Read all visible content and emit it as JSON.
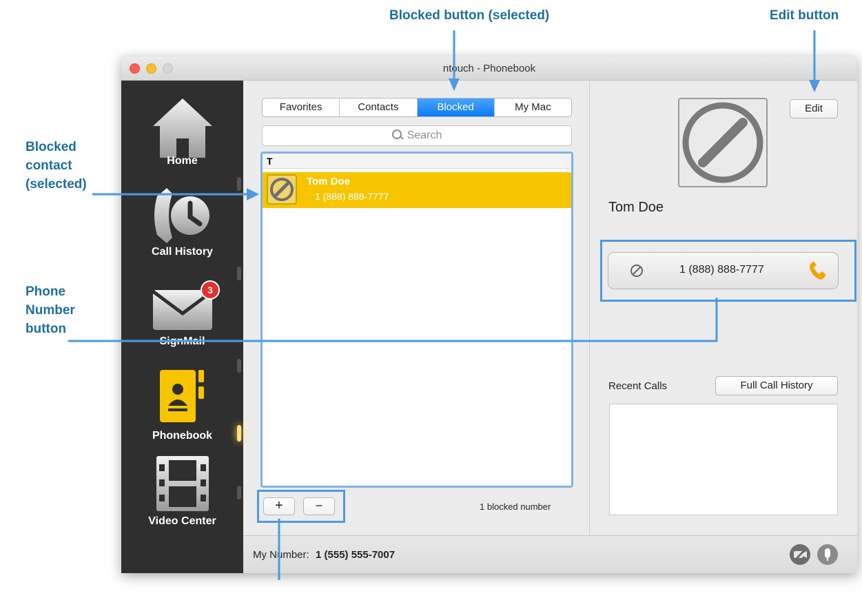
{
  "callouts": {
    "blocked_button": "Blocked button (selected)",
    "edit_button": "Edit button",
    "blocked_contact": [
      "Blocked",
      "contact",
      "(selected)"
    ],
    "phone_number_button": [
      "Phone",
      "Number",
      "button"
    ]
  },
  "window": {
    "title": "ntouch - Phonebook"
  },
  "sidebar": {
    "items": [
      {
        "label": "Home",
        "icon": "home-icon"
      },
      {
        "label": "Call History",
        "icon": "call-history-icon"
      },
      {
        "label": "SignMail",
        "icon": "signmail-icon",
        "badge": "3"
      },
      {
        "label": "Phonebook",
        "icon": "phonebook-icon",
        "active": true
      },
      {
        "label": "Video Center",
        "icon": "video-center-icon"
      }
    ]
  },
  "tabs": [
    {
      "label": "Favorites"
    },
    {
      "label": "Contacts"
    },
    {
      "label": "Blocked",
      "selected": true
    },
    {
      "label": "My Mac"
    }
  ],
  "search": {
    "placeholder": "Search"
  },
  "list": {
    "section_header": "T",
    "contacts": [
      {
        "name": "Tom Doe",
        "number": "1 (888) 888-7777",
        "selected": true
      }
    ]
  },
  "list_footer": {
    "add_label": "+",
    "remove_label": "−",
    "count_text": "1 blocked number"
  },
  "detail": {
    "edit_label": "Edit",
    "contact_name": "Tom Doe",
    "phone_number": "1 (888) 888-7777",
    "recent_calls_label": "Recent Calls",
    "full_history_label": "Full Call History"
  },
  "footer": {
    "my_number_label": "My Number:",
    "my_number_value": "1 (555) 555-7007"
  },
  "colors": {
    "accent": "#0a7cf5",
    "selected_row": "#f7c500",
    "callout_text": "#1f6f9c",
    "callout_line": "#4d9ae0",
    "sidebar_bg": "#2f2f2f",
    "badge": "#e0312b"
  }
}
